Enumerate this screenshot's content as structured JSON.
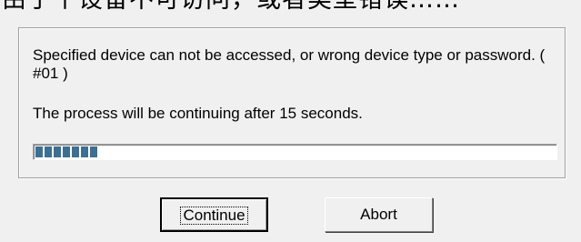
{
  "top_strip": {
    "text": "由于个设备不可访问，或者类型错误……"
  },
  "message": {
    "error_text": "Specified device can not be accessed, or wrong device type or password. ( #01 )",
    "countdown_text": "The process will be continuing after 15 seconds."
  },
  "progress": {
    "fraction": 0.15,
    "segments": 7
  },
  "buttons": {
    "continue_label": "Continue",
    "abort_label": "Abort"
  },
  "colors": {
    "progress_fill": "#3d6f93",
    "background": "#f0f0f0"
  }
}
